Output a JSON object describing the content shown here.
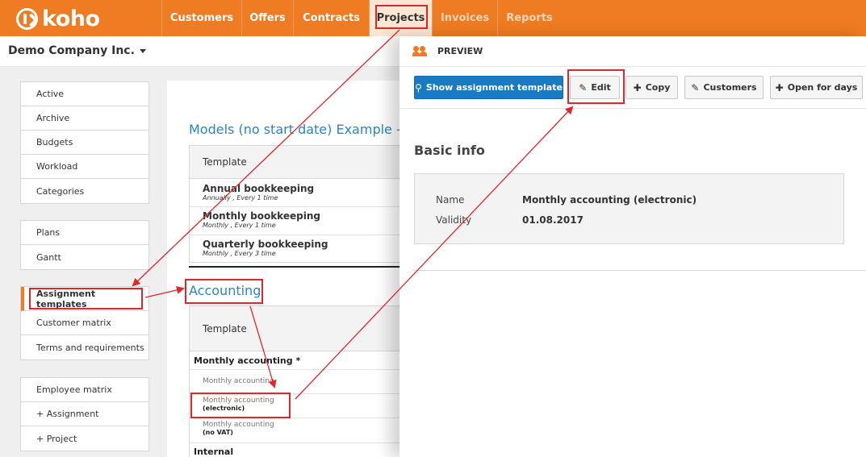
{
  "app": {
    "logo_text": "koho",
    "brand_color": "#ef7b22"
  },
  "nav": [
    {
      "label": "Customers"
    },
    {
      "label": "Offers"
    },
    {
      "label": "Contracts"
    },
    {
      "label": "Projects"
    },
    {
      "label": "Invoices"
    },
    {
      "label": "Reports"
    }
  ],
  "company": {
    "name": "Demo Company Inc."
  },
  "sidebar": {
    "group1": [
      "Active",
      "Archive",
      "Budgets",
      "Workload",
      "Categories"
    ],
    "group2": [
      "Plans",
      "Gantt"
    ],
    "group3": [
      "Assignment templates",
      "Customer matrix",
      "Terms and requirements"
    ],
    "group4": [
      "Employee matrix",
      "+ Assignment",
      "+ Project"
    ]
  },
  "main": {
    "section1": {
      "heading": "Models (no start date) Example - B",
      "header": "Template",
      "rows": [
        {
          "title": "Annual bookkeeping",
          "sub": "Annually , Every 1 time"
        },
        {
          "title": "Monthly bookkeeping",
          "sub": "Monthly , Every 1 time"
        },
        {
          "title": "Quarterly bookkeeping",
          "sub": "Monthly , Every 3 time"
        }
      ]
    },
    "section2": {
      "heading": "Accounting",
      "header": "Template",
      "group": "Monthly accounting *",
      "rows": [
        {
          "line1": "Monthly accounting",
          "line2": ""
        },
        {
          "line1": "Monthly accounting",
          "line2": "(electronic)"
        },
        {
          "line1": "Monthly accounting",
          "line2": "(no VAT)"
        }
      ],
      "group2": "Internal"
    }
  },
  "preview": {
    "title": "PREVIEW",
    "buttons": {
      "show_template": "Show assignment template",
      "edit": "Edit",
      "copy": "Copy",
      "customers": "Customers",
      "open_for_days": "Open for days"
    },
    "basic_info_title": "Basic info",
    "fields": [
      {
        "label": "Name",
        "value": "Monthly accounting (electronic)"
      },
      {
        "label": "Validity",
        "value": "01.08.2017"
      }
    ]
  },
  "annotation_color": "#e0262a"
}
